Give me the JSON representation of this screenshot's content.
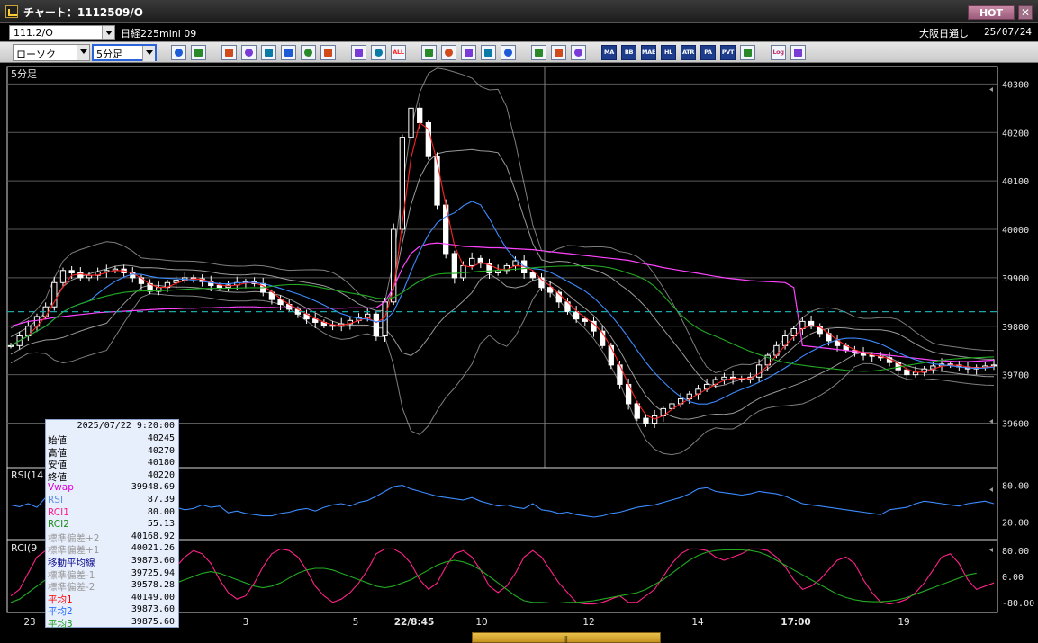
{
  "window": {
    "title": "チャート：1112509/O",
    "hot": "HOT",
    "close": "✕"
  },
  "symbol_bar": {
    "symbol_code": "111.2/O",
    "symbol_name": "日経225mini 09",
    "session": "大阪日通し",
    "date": "25/07/24"
  },
  "toolbar": {
    "chart_type": "ローソク",
    "period": "5分足",
    "buttons": [
      {
        "name": "zoom-icon",
        "label": ""
      },
      {
        "name": "window-icon",
        "label": ""
      },
      {
        "name": "pen-icon",
        "label": ""
      },
      {
        "name": "link-icon",
        "label": ""
      },
      {
        "name": "cursor-icon",
        "label": ""
      },
      {
        "name": "refresh-icon",
        "label": ""
      },
      {
        "name": "list-icon",
        "label": ""
      },
      {
        "name": "trash-icon",
        "label": ""
      },
      {
        "name": "candle-left-icon",
        "label": ""
      },
      {
        "name": "candle-right-icon",
        "label": ""
      },
      {
        "name": "all-button",
        "label": "ALL"
      },
      {
        "name": "drop-icon",
        "label": ""
      },
      {
        "name": "magnify-icon",
        "label": ""
      },
      {
        "name": "bar-chart-icon",
        "label": ""
      },
      {
        "name": "split-icon",
        "label": ""
      },
      {
        "name": "info-icon",
        "label": ""
      },
      {
        "name": "grid-icon",
        "label": ""
      },
      {
        "name": "brush-icon",
        "label": ""
      },
      {
        "name": "palette-icon",
        "label": ""
      },
      {
        "name": "ma-button",
        "label": "MA"
      },
      {
        "name": "bb-button",
        "label": "BB"
      },
      {
        "name": "mae-button",
        "label": "MAE"
      },
      {
        "name": "hl-button",
        "label": "HL"
      },
      {
        "name": "atr-button",
        "label": "ATR"
      },
      {
        "name": "pa-button",
        "label": "PA"
      },
      {
        "name": "pvt-button",
        "label": "PVT"
      },
      {
        "name": "frame-icon",
        "label": ""
      },
      {
        "name": "log-button",
        "label": "Log"
      },
      {
        "name": "export-icon",
        "label": ""
      }
    ]
  },
  "chart_data": {
    "type": "line",
    "period_label": "5分足",
    "colors": {
      "candle": "#ffffff",
      "bb_band": "#b4b4b4",
      "vwap": "#ff44ff",
      "ma_short": "#ff2222",
      "ma_mid": "#3c8cff",
      "ma_long": "#22aa22",
      "rsi": "#3c8cff",
      "rci1": "#ff2288",
      "rci2": "#22aa22",
      "ref_line": "#1aa7a7",
      "cursor": "#808080"
    },
    "price_axis": {
      "ticks": [
        40300,
        40200,
        40100,
        40000,
        39900,
        39800,
        39700,
        39600
      ],
      "range": [
        39510,
        40310
      ]
    },
    "reference_line_value": 39830,
    "x_labels": [
      "23",
      "3",
      "5",
      "22/8:45",
      "10",
      "12",
      "14",
      "17:00",
      "19"
    ],
    "rsi_panel": {
      "label": "RSI(14",
      "ticks": [
        "80.00",
        "20.00"
      ]
    },
    "rci_panel": {
      "label": "RCI(9",
      "ticks": [
        "80.00",
        "0.00",
        "-80.00"
      ]
    },
    "price_series": [
      39760,
      39780,
      39800,
      39820,
      39840,
      39890,
      39915,
      39910,
      39900,
      39905,
      39912,
      39915,
      39918,
      39910,
      39900,
      39888,
      39872,
      39880,
      39890,
      39895,
      39900,
      39898,
      39892,
      39884,
      39880,
      39885,
      39890,
      39892,
      39888,
      39870,
      39855,
      39845,
      39835,
      39825,
      39815,
      39808,
      39802,
      39800,
      39805,
      39812,
      39818,
      39825,
      39780,
      39850,
      40000,
      40190,
      40250,
      40220,
      40150,
      40050,
      39950,
      39900,
      39925,
      39940,
      39930,
      39910,
      39915,
      39925,
      39935,
      39910,
      39900,
      39880,
      39870,
      39850,
      39830,
      39815,
      39810,
      39790,
      39760,
      39720,
      39680,
      39640,
      39610,
      39600,
      39615,
      39630,
      39640,
      39650,
      39660,
      39670,
      39680,
      39690,
      39695,
      39692,
      39690,
      39695,
      39720,
      39740,
      39760,
      39780,
      39795,
      39810,
      39800,
      39785,
      39770,
      39760,
      39750,
      39745,
      39740,
      39738,
      39735,
      39725,
      39710,
      39700,
      39705,
      39712,
      39718,
      39722,
      39720,
      39716,
      39712,
      39715,
      39718,
      39720
    ],
    "vwap": [
      39800,
      39805,
      39810,
      39812,
      39815,
      39818,
      39820,
      39822,
      39824,
      39826,
      39828,
      39829,
      39830,
      39831,
      39832,
      39833,
      39834,
      39835,
      39836,
      39836,
      39837,
      39837,
      39838,
      39838,
      39839,
      39839,
      39840,
      39840,
      39840,
      39839,
      39839,
      39838,
      39838,
      39838,
      39837,
      39837,
      39837,
      39837,
      39837,
      39838,
      39838,
      39838,
      39838,
      39850,
      39880,
      39920,
      39950,
      39965,
      39970,
      39972,
      39970,
      39968,
      39965,
      39964,
      39963,
      39962,
      39962,
      39961,
      39960,
      39959,
      39958,
      39956,
      39954,
      39952,
      39950,
      39948,
      39946,
      39944,
      39942,
      39940,
      39938,
      39936,
      39932,
      39928,
      39925,
      39921,
      39918,
      39915,
      39912,
      39909,
      39906,
      39903,
      39900,
      39898,
      39896,
      39894,
      39893,
      39892,
      39891,
      39890,
      39880,
      39760,
      39758,
      39756,
      39754,
      39752,
      39750,
      39748,
      39746,
      39744,
      39742,
      39740,
      39738,
      39736,
      39734,
      39732,
      39730,
      39729,
      39728,
      39727,
      39727,
      39728,
      39729,
      39730
    ],
    "rsi_series": [
      48,
      45,
      50,
      44,
      60,
      58,
      52,
      55,
      45,
      50,
      46,
      42,
      55,
      48,
      38,
      44,
      40,
      46,
      50,
      44,
      40,
      42,
      48,
      44,
      46,
      35,
      38,
      34,
      32,
      30,
      30,
      34,
      36,
      40,
      42,
      38,
      44,
      48,
      50,
      46,
      52,
      55,
      62,
      70,
      78,
      80,
      74,
      70,
      66,
      62,
      60,
      58,
      56,
      60,
      54,
      50,
      46,
      48,
      44,
      42,
      50,
      40,
      38,
      34,
      36,
      32,
      30,
      28,
      30,
      34,
      36,
      40,
      44,
      46,
      48,
      52,
      56,
      60,
      66,
      74,
      76,
      70,
      68,
      66,
      64,
      66,
      70,
      68,
      66,
      62,
      56,
      50,
      48,
      46,
      44,
      42,
      40,
      38,
      36,
      34,
      32,
      40,
      42,
      44,
      50,
      54,
      52,
      50,
      48,
      46,
      50,
      52,
      54,
      50
    ],
    "rci1_series": [
      -60,
      -40,
      10,
      60,
      80,
      70,
      30,
      -30,
      -60,
      -20,
      20,
      50,
      30,
      -20,
      -60,
      -70,
      -60,
      -40,
      -10,
      30,
      60,
      80,
      70,
      40,
      -10,
      -50,
      -70,
      -60,
      -20,
      30,
      70,
      85,
      80,
      60,
      20,
      -30,
      -60,
      -80,
      -70,
      -50,
      -20,
      20,
      70,
      85,
      85,
      70,
      40,
      -10,
      -40,
      -20,
      30,
      70,
      80,
      60,
      20,
      -30,
      -50,
      -30,
      10,
      60,
      80,
      60,
      20,
      -20,
      -50,
      -80,
      -85,
      -85,
      -80,
      -70,
      -60,
      -80,
      -80,
      -60,
      -40,
      0,
      40,
      70,
      85,
      85,
      80,
      60,
      50,
      60,
      70,
      85,
      85,
      80,
      60,
      30,
      -10,
      -40,
      -30,
      -10,
      20,
      50,
      60,
      40,
      -10,
      -50,
      -80,
      -85,
      -80,
      -70,
      -50,
      -20,
      20,
      60,
      70,
      40,
      -10,
      -40,
      -30,
      -20
    ],
    "rci2_series": [
      -80,
      -70,
      -50,
      -30,
      -10,
      0,
      -5,
      -10,
      -20,
      -30,
      -30,
      -25,
      -20,
      -20,
      -30,
      -40,
      -45,
      -40,
      -30,
      -20,
      -10,
      0,
      10,
      15,
      10,
      0,
      -10,
      -20,
      -30,
      -35,
      -30,
      -20,
      -5,
      10,
      20,
      25,
      25,
      20,
      10,
      0,
      -10,
      -20,
      -30,
      -35,
      -30,
      -20,
      -10,
      5,
      20,
      35,
      45,
      50,
      45,
      35,
      20,
      0,
      -20,
      -40,
      -60,
      -75,
      -80,
      -80,
      -82,
      -82,
      -80,
      -80,
      -78,
      -75,
      -70,
      -65,
      -60,
      -55,
      -50,
      -40,
      -25,
      -10,
      10,
      30,
      50,
      65,
      75,
      80,
      82,
      82,
      82,
      80,
      75,
      65,
      50,
      35,
      20,
      5,
      -10,
      -25,
      -40,
      -55,
      -65,
      -72,
      -76,
      -78,
      -78,
      -76,
      -72,
      -65,
      -55,
      -45,
      -35,
      -25,
      -15,
      -5,
      5,
      10
    ]
  },
  "data_window": {
    "timestamp": "2025/07/22 9:20:00",
    "rows": [
      {
        "key": "始値",
        "value": "40245",
        "color": "#000000"
      },
      {
        "key": "高値",
        "value": "40270",
        "color": "#000000"
      },
      {
        "key": "安値",
        "value": "40180",
        "color": "#000000"
      },
      {
        "key": "終値",
        "value": "40220",
        "color": "#000000"
      },
      {
        "key": "Vwap",
        "value": "39948.69",
        "color": "#d800d8"
      },
      {
        "key": "RSI",
        "value": "87.39",
        "color": "#5c8fe6"
      },
      {
        "key": "RCI1",
        "value": "80.00",
        "color": "#ff1a8c"
      },
      {
        "key": "RCI2",
        "value": "55.13",
        "color": "#1e8c1e"
      },
      {
        "key": "標準偏差+2",
        "value": "40168.92",
        "color": "#9a9a9a"
      },
      {
        "key": "標準偏差+1",
        "value": "40021.26",
        "color": "#9a9a9a"
      },
      {
        "key": "移動平均線",
        "value": "39873.60",
        "color": "#0a0a8c"
      },
      {
        "key": "標準偏差-1",
        "value": "39725.94",
        "color": "#9a9a9a"
      },
      {
        "key": "標準偏差-2",
        "value": "39578.28",
        "color": "#9a9a9a"
      },
      {
        "key": "平均1",
        "value": "40149.00",
        "color": "#ff0000"
      },
      {
        "key": "平均2",
        "value": "39873.60",
        "color": "#1a66ff"
      },
      {
        "key": "平均3",
        "value": "39875.60",
        "color": "#1a9a1a"
      }
    ]
  },
  "scrollbar": {
    "grip": "|||"
  }
}
